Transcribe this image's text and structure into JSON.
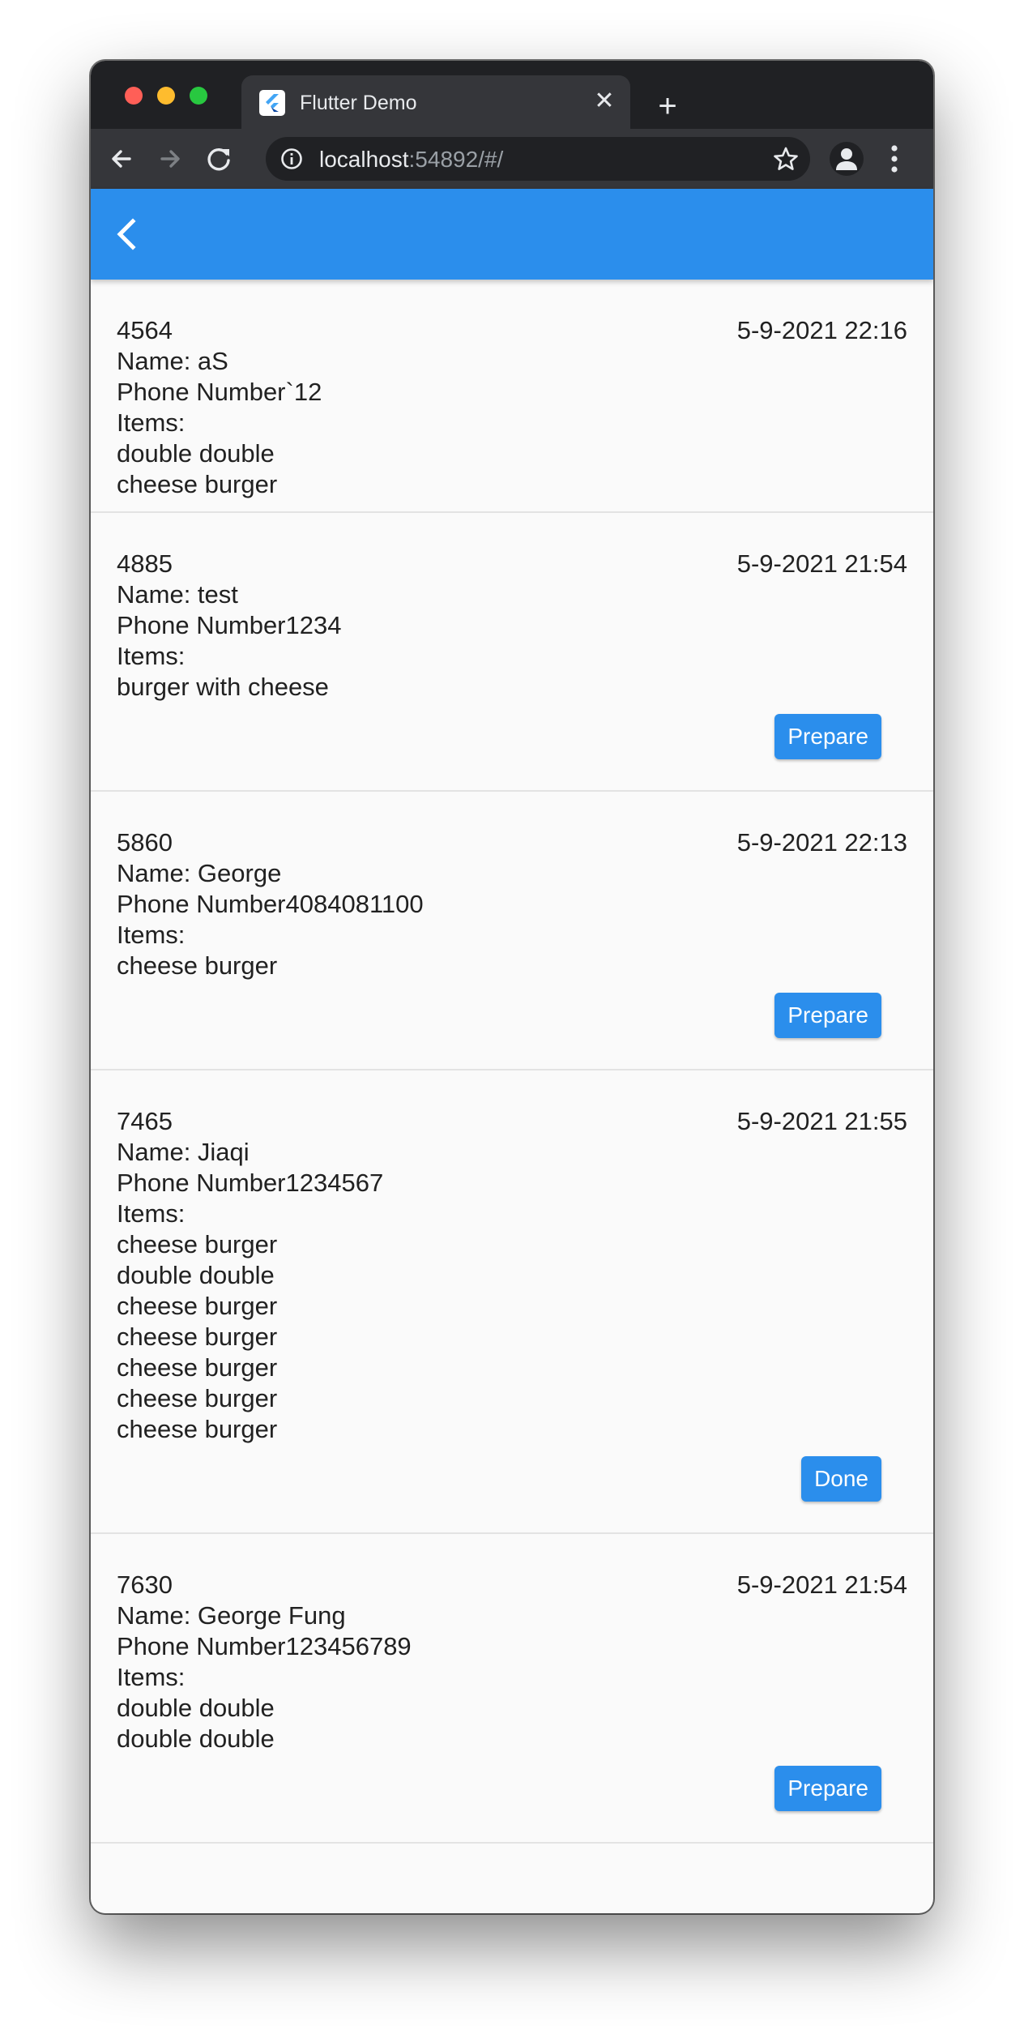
{
  "browser": {
    "tab_title": "Flutter Demo",
    "url_host": "localhost",
    "url_rest": ":54892/#/"
  },
  "icons": {
    "back": "back-arrow-icon",
    "forward": "forward-arrow-icon",
    "reload": "reload-icon",
    "info": "info-icon",
    "star": "star-icon",
    "profile": "profile-icon",
    "menu": "menu-dots-icon",
    "appbar_back": "chevron-left-icon",
    "favicon": "flutter-logo-icon"
  },
  "colors": {
    "accent": "#2b8eec",
    "chrome_dark": "#202124",
    "chrome_tab": "#35363a"
  },
  "orders": [
    {
      "id": "4564",
      "time": "5-9-2021 22:16",
      "name": "Name: aS",
      "phone": "Phone Number`12",
      "items_label": "Items:",
      "items": [
        "double double",
        "cheese burger"
      ],
      "action": ""
    },
    {
      "id": "4885",
      "time": "5-9-2021 21:54",
      "name": "Name: test",
      "phone": "Phone Number1234",
      "items_label": "Items:",
      "items": [
        "burger with cheese"
      ],
      "action": "Prepare"
    },
    {
      "id": "5860",
      "time": "5-9-2021 22:13",
      "name": "Name: George",
      "phone": "Phone Number4084081100",
      "items_label": "Items:",
      "items": [
        "cheese burger"
      ],
      "action": "Prepare"
    },
    {
      "id": "7465",
      "time": "5-9-2021 21:55",
      "name": "Name: Jiaqi",
      "phone": "Phone Number1234567",
      "items_label": "Items:",
      "items": [
        "cheese burger",
        "double double",
        "cheese burger",
        "cheese burger",
        "cheese burger",
        "cheese burger",
        "cheese burger"
      ],
      "action": "Done"
    },
    {
      "id": "7630",
      "time": "5-9-2021 21:54",
      "name": "Name: George Fung",
      "phone": "Phone Number123456789",
      "items_label": "Items:",
      "items": [
        "double double",
        "double double"
      ],
      "action": "Prepare"
    }
  ]
}
